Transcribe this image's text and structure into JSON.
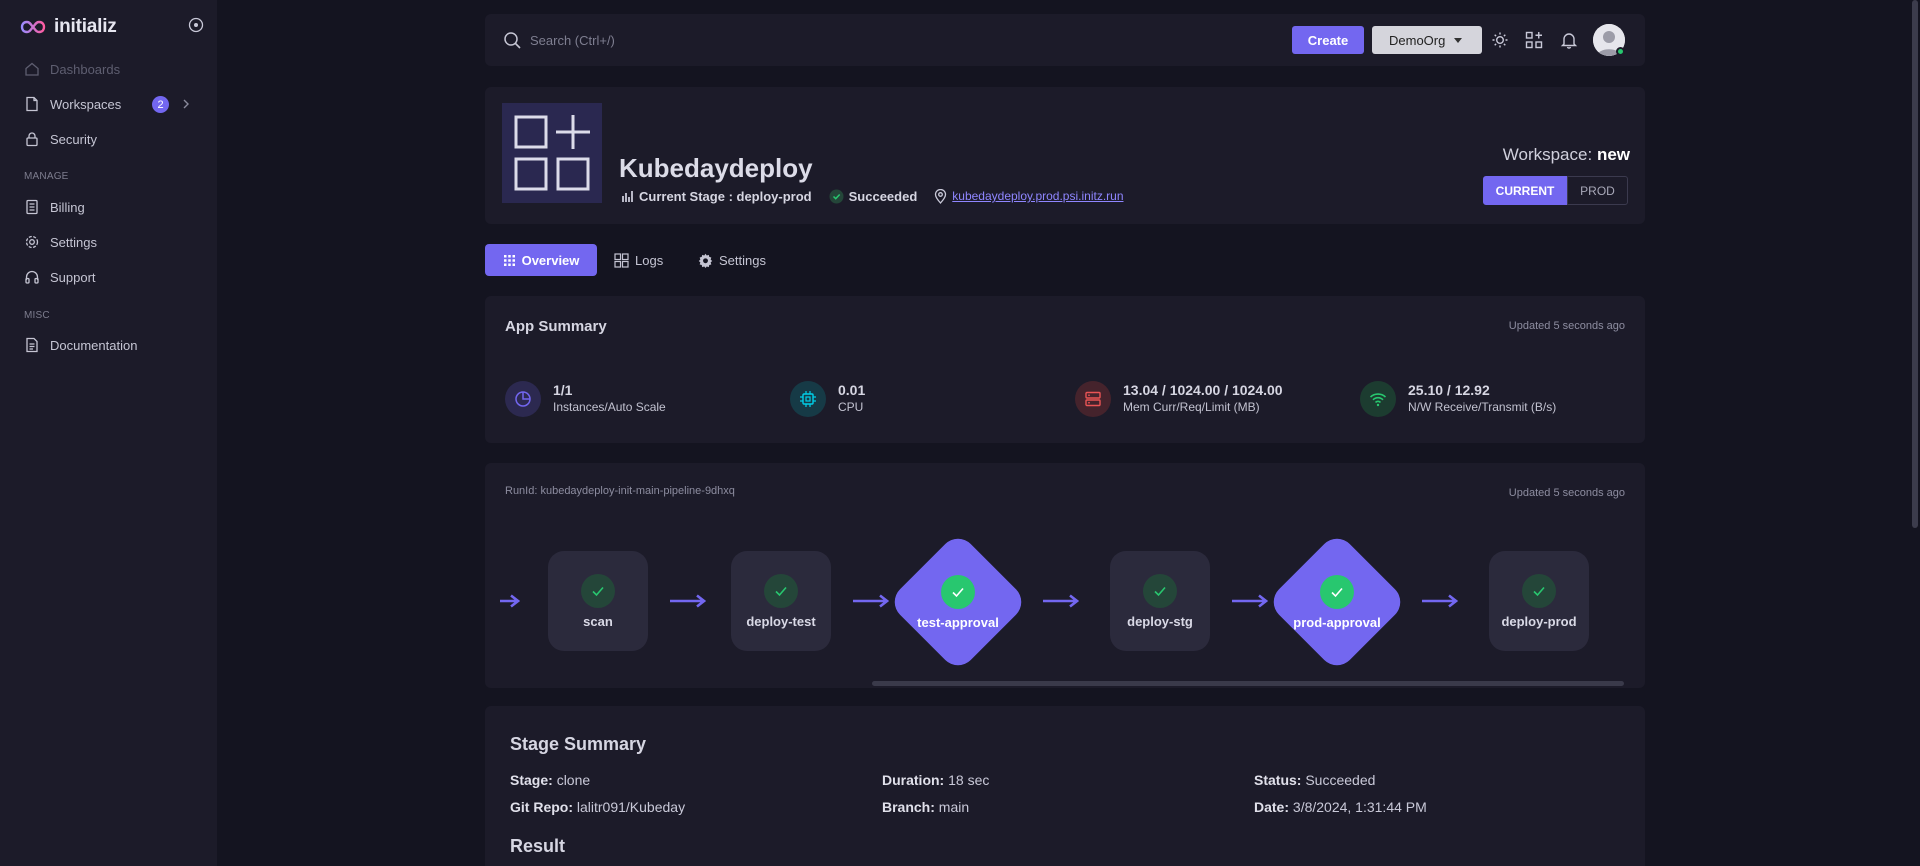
{
  "brand": {
    "name": "initializ"
  },
  "sidebar": {
    "items": [
      {
        "label": "Dashboards",
        "icon": "home-icon"
      },
      {
        "label": "Workspaces",
        "icon": "file-icon",
        "badge": "2"
      },
      {
        "label": "Security",
        "icon": "lock-icon"
      }
    ],
    "sections": [
      {
        "title": "MANAGE",
        "items": [
          {
            "label": "Billing",
            "icon": "receipt-icon"
          },
          {
            "label": "Settings",
            "icon": "gear-icon"
          },
          {
            "label": "Support",
            "icon": "headphones-icon"
          }
        ]
      },
      {
        "title": "MISC",
        "items": [
          {
            "label": "Documentation",
            "icon": "document-icon"
          }
        ]
      }
    ]
  },
  "topbar": {
    "search_placeholder": "Search (Ctrl+/)",
    "create_label": "Create",
    "org_label": "DemoOrg"
  },
  "app": {
    "title": "Kubedaydeploy",
    "current_stage": "Current Stage : deploy-prod",
    "status": "Succeeded",
    "url": "kubedaydeploy.prod.psi.initz.run",
    "workspace_prefix": "Workspace:",
    "workspace_name": "new",
    "env_current": "CURRENT",
    "env_prod": "PROD"
  },
  "tabs": [
    {
      "label": "Overview",
      "icon": "grid-icon",
      "active": true
    },
    {
      "label": "Logs",
      "icon": "logs-icon",
      "active": false
    },
    {
      "label": "Settings",
      "icon": "gear-icon",
      "active": false
    }
  ],
  "summary": {
    "title": "App Summary",
    "updated": "Updated 5 seconds ago",
    "stats": [
      {
        "value": "1/1",
        "label": "Instances/Auto Scale",
        "icon": "pie-icon",
        "color": "#7367f0"
      },
      {
        "value": "0.01",
        "label": "CPU",
        "icon": "cpu-icon",
        "color": "#00cfe8"
      },
      {
        "value": "13.04 / 1024.00 / 1024.00",
        "label": "Mem Curr/Req/Limit (MB)",
        "icon": "server-icon",
        "color": "#ea5455"
      },
      {
        "value": "25.10 / 12.92",
        "label": "N/W Receive/Transmit (B/s)",
        "icon": "wifi-icon",
        "color": "#28c76f"
      }
    ]
  },
  "pipeline": {
    "run_id": "RunId: kubedaydeploy-init-main-pipeline-9dhxq",
    "updated": "Updated 5 seconds ago",
    "stages": [
      {
        "label": "scan",
        "kind": "step"
      },
      {
        "label": "deploy-test",
        "kind": "step"
      },
      {
        "label": "test-approval",
        "kind": "approval"
      },
      {
        "label": "deploy-stg",
        "kind": "step"
      },
      {
        "label": "prod-approval",
        "kind": "approval"
      },
      {
        "label": "deploy-prod",
        "kind": "step"
      }
    ]
  },
  "stage_summary": {
    "title": "Stage Summary",
    "stage_key": "Stage:",
    "stage_val": "clone",
    "duration_key": "Duration:",
    "duration_val": "18 sec",
    "status_key": "Status:",
    "status_val": "Succeeded",
    "repo_key": "Git Repo:",
    "repo_val": "lalitr091/Kubeday",
    "branch_key": "Branch:",
    "branch_val": "main",
    "date_key": "Date:",
    "date_val": "3/8/2024, 1:31:44 PM",
    "result_title": "Result"
  },
  "colors": {
    "accent": "#7367f0",
    "success": "#28c76f",
    "surface": "#1c1b29",
    "background": "#141420"
  }
}
